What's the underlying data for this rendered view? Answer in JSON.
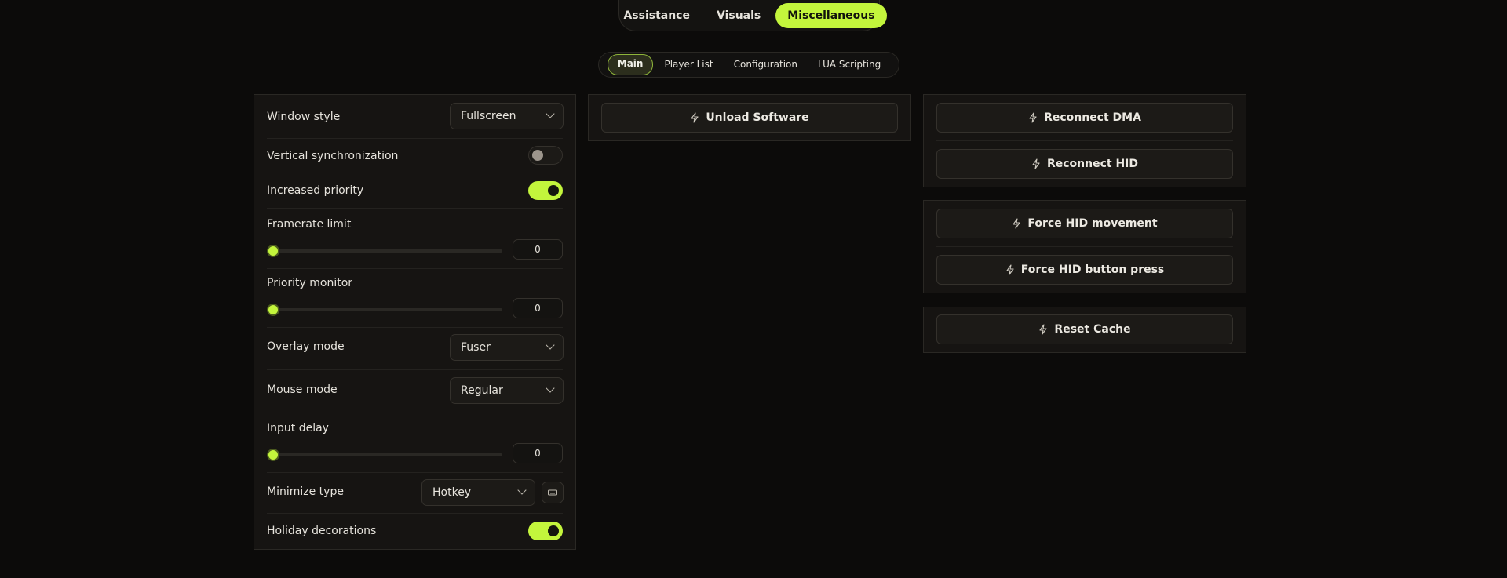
{
  "top_tabs": [
    {
      "label": "Assistance",
      "active": false
    },
    {
      "label": "Visuals",
      "active": false
    },
    {
      "label": "Miscellaneous",
      "active": true
    }
  ],
  "sub_tabs": [
    {
      "label": "Main",
      "active": true
    },
    {
      "label": "Player List",
      "active": false
    },
    {
      "label": "Configuration",
      "active": false
    },
    {
      "label": "LUA Scripting",
      "active": false
    }
  ],
  "settings": {
    "window_style": {
      "label": "Window style",
      "value": "Fullscreen"
    },
    "vsync": {
      "label": "Vertical synchronization",
      "enabled": false
    },
    "increased_priority": {
      "label": "Increased priority",
      "enabled": true
    },
    "framerate_limit": {
      "label": "Framerate limit",
      "value": "0"
    },
    "priority_monitor": {
      "label": "Priority monitor",
      "value": "0"
    },
    "overlay_mode": {
      "label": "Overlay mode",
      "value": "Fuser"
    },
    "mouse_mode": {
      "label": "Mouse mode",
      "value": "Regular"
    },
    "input_delay": {
      "label": "Input delay",
      "value": "0"
    },
    "minimize_type": {
      "label": "Minimize type",
      "value": "Hotkey"
    },
    "holiday_decorations": {
      "label": "Holiday decorations",
      "enabled": true
    }
  },
  "actions": {
    "unload": "Unload Software",
    "reconnect_dma": "Reconnect DMA",
    "reconnect_hid": "Reconnect HID",
    "force_hid_movement": "Force HID movement",
    "force_hid_button": "Force HID button press",
    "reset_cache": "Reset Cache"
  },
  "colors": {
    "accent": "#c3f53c",
    "background": "#0c0b0a",
    "panel": "#161412",
    "border": "#2a2824"
  },
  "icons": {
    "action": "lightning-bolt-icon",
    "dropdown": "chevron-down-icon",
    "hotkey": "keyboard-icon"
  }
}
